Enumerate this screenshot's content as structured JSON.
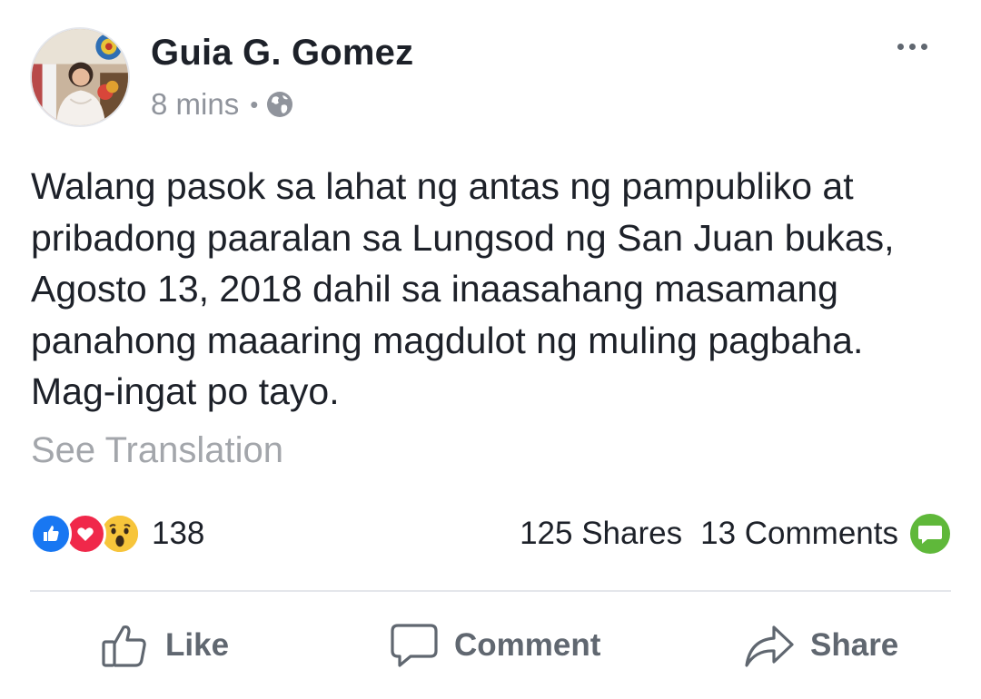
{
  "post": {
    "author": "Guia G. Gomez",
    "timestamp": "8 mins",
    "separator": "•",
    "privacy_icon": "globe-icon",
    "more_icon": "more-options-icon",
    "text_lines": [
      "Walang pasok sa lahat ng antas ng pampubliko at",
      "pribadong paaralan sa Lungsod ng San Juan bukas,",
      "Agosto 13, 2018 dahil sa inaasahang masamang",
      "panahong maaaring magdulot ng muling pagbaha.",
      "Mag-ingat po tayo."
    ],
    "see_translation": "See Translation"
  },
  "reactions": {
    "icons": [
      "like-reaction-icon",
      "love-reaction-icon",
      "wow-reaction-icon"
    ],
    "count": "138"
  },
  "counts": {
    "shares": "125 Shares",
    "comments": "13 Comments",
    "comment_icon": "comment-bubble-icon"
  },
  "actions": {
    "like": "Like",
    "comment": "Comment",
    "share": "Share"
  },
  "colors": {
    "like_blue": "#1877f2",
    "love_red": "#f0284a",
    "wow_yellow": "#f7b125",
    "comment_green": "#5fb83a",
    "muted_text": "#90949c"
  }
}
